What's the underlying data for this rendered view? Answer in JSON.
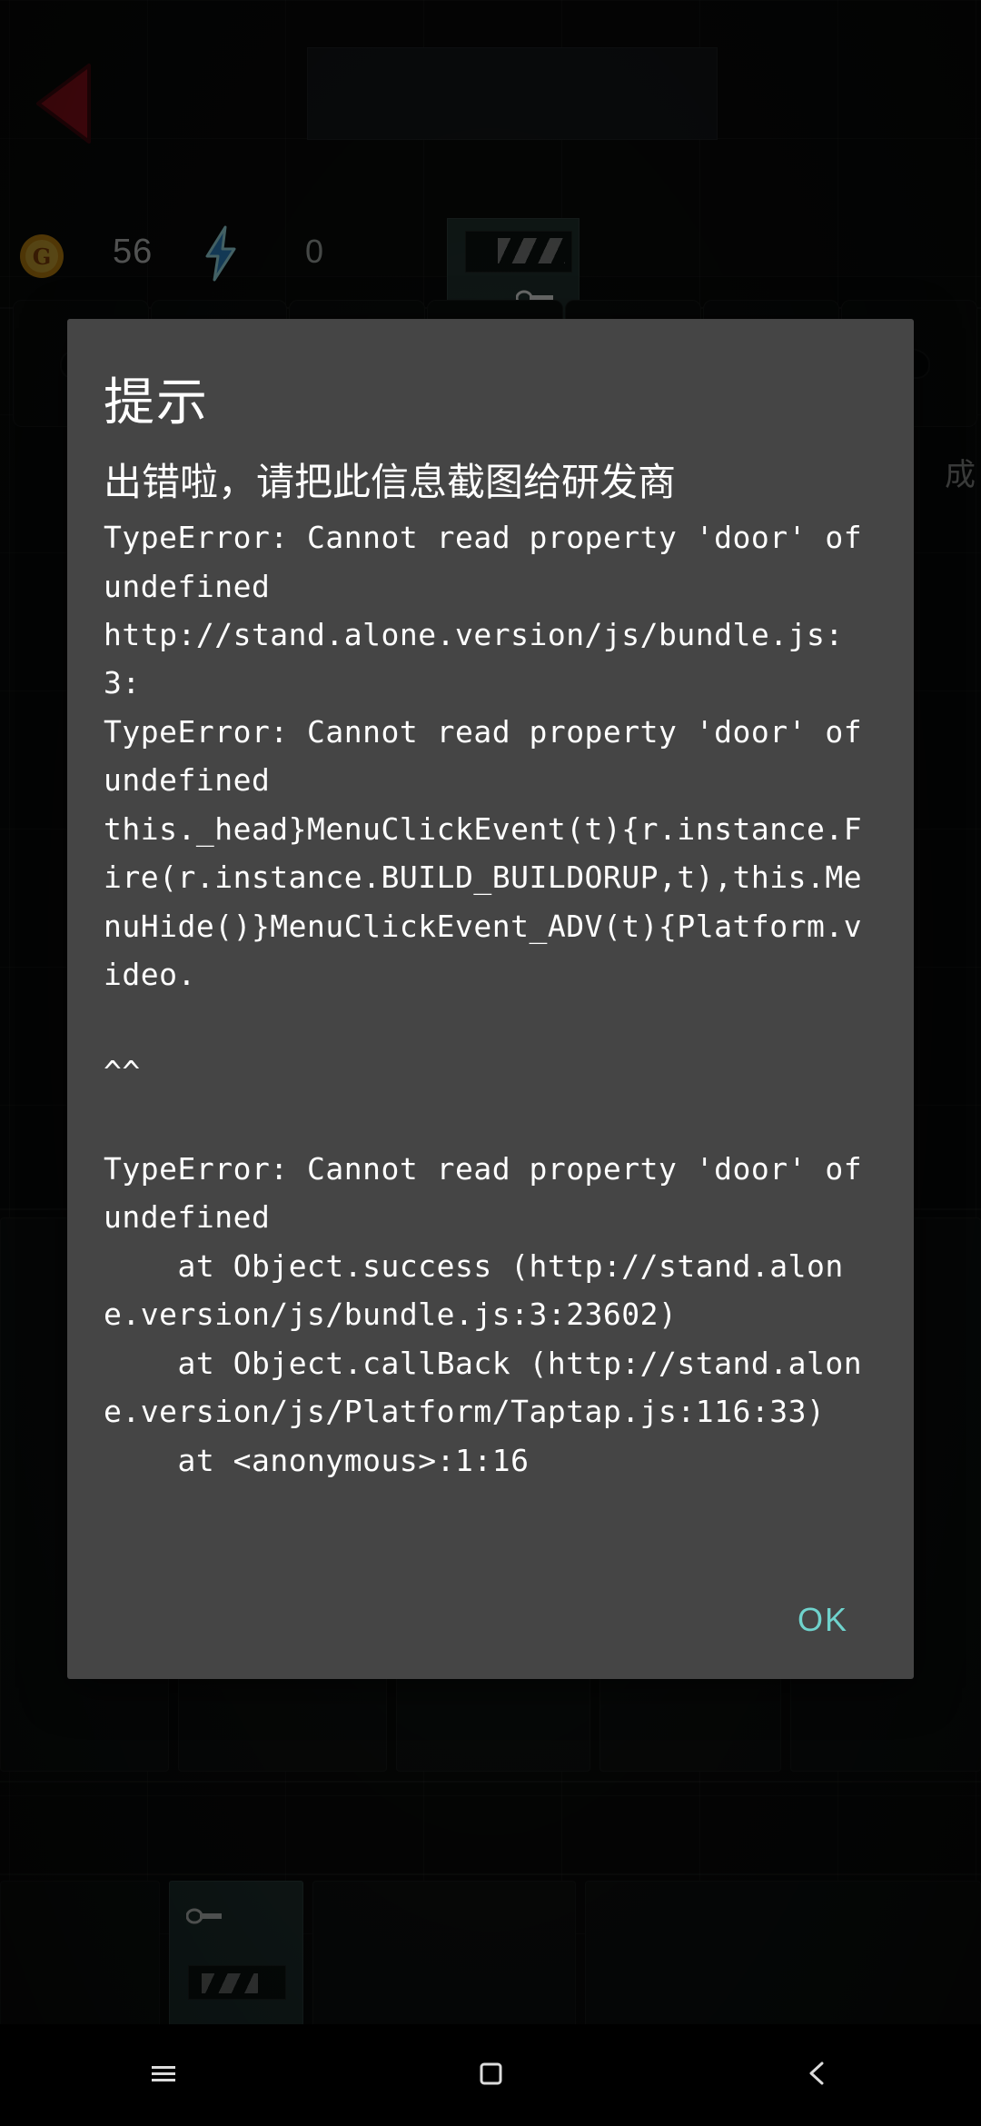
{
  "game_hud": {
    "back_icon": "back-arrow-icon",
    "coin_icon": "coin-icon",
    "coin_count": "56",
    "energy_icon": "lightning-bolt-icon",
    "energy_count": "0",
    "right_faint_text": "成",
    "colors": {
      "coin_gold": "#e8a317",
      "coin_ring": "#f5c842",
      "bolt_cyan": "#5fd4e8",
      "bolt_blue": "#2f7fd6",
      "back_arrow_red": "#b01525",
      "machine_green": "#20302c"
    }
  },
  "dialog": {
    "title": "提示",
    "message_cn": "出错啦，请把此信息截图给研发商",
    "stack_trace": "TypeError: Cannot read property 'door' of undefined\nhttp://stand.alone.version/js/bundle.js:3:\nTypeError: Cannot read property 'door' of undefined\nthis._head}MenuClickEvent(t){r.instance.Fire(r.instance.BUILD_BUILDORUP,t),this.MenuHide()}MenuClickEvent_ADV(t){Platform.video.\n\n^^\n\nTypeError: Cannot read property 'door' of undefined\n    at Object.success (http://stand.alone.version/js/bundle.js:3:23602)\n    at Object.callBack (http://stand.alone.version/js/Platform/Taptap.js:116:33)\n    at <anonymous>:1:16",
    "ok_label": "OK",
    "colors": {
      "background": "#454545",
      "text": "#ffffff",
      "accent": "#6fd3cd"
    }
  },
  "nav_bar": {
    "recents_icon": "menu-hamburger-icon",
    "home_icon": "home-square-icon",
    "back_icon": "back-chevron-icon"
  }
}
